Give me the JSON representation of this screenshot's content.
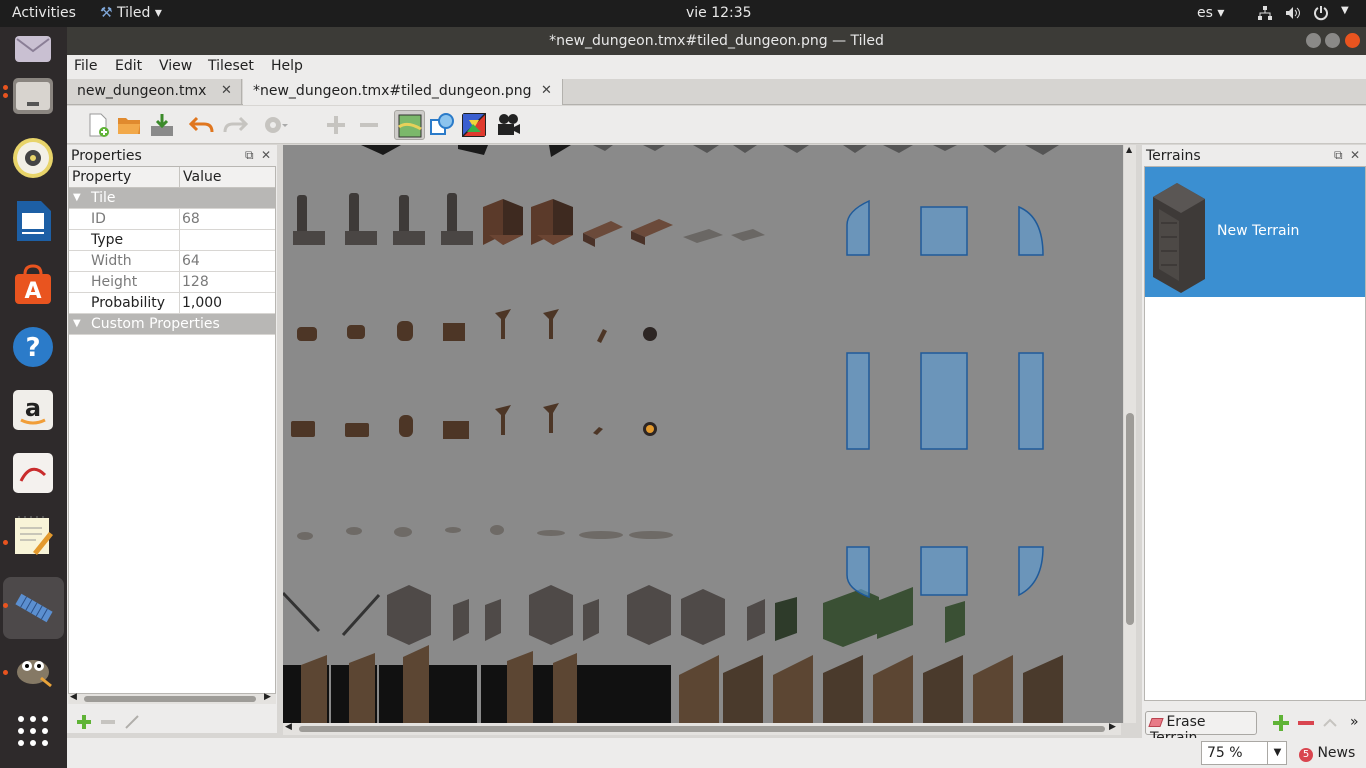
{
  "topbar": {
    "activities": "Activities",
    "app_menu": "Tiled ▾",
    "clock": "vie 12:35",
    "language": "es ▾"
  },
  "dock": {
    "items": [
      "mail-icon",
      "files-icon",
      "rhythmbox-icon",
      "writer-icon",
      "software-center-icon",
      "help-icon",
      "amazon-icon",
      "document-viewer-icon",
      "text-editor-icon",
      "tiled-icon",
      "gimp-icon",
      "apps-grid-icon"
    ]
  },
  "window": {
    "title": "*new_dungeon.tmx#tiled_dungeon.png — Tiled"
  },
  "menubar": {
    "file": "File",
    "edit": "Edit",
    "view": "View",
    "tileset": "Tileset",
    "help": "Help"
  },
  "tabs": [
    {
      "label": "new_dungeon.tmx"
    },
    {
      "label": "*new_dungeon.tmx#tiled_dungeon.png"
    }
  ],
  "properties": {
    "title": "Properties",
    "col_property": "Property",
    "col_value": "Value",
    "group_tile": "Tile",
    "rows": [
      {
        "name": "ID",
        "value": "68"
      },
      {
        "name": "Type",
        "value": ""
      },
      {
        "name": "Width",
        "value": "64"
      },
      {
        "name": "Height",
        "value": "128"
      },
      {
        "name": "Probability",
        "value": "1,000"
      }
    ],
    "group_custom": "Custom Properties"
  },
  "terrains": {
    "title": "Terrains",
    "item_label": "New Terrain",
    "erase_label": "Erase Terrain"
  },
  "status": {
    "zoom": "75 %",
    "news": "News"
  },
  "colors": {
    "selection": "#3b8fd1",
    "terrain_overlay": "#5a9bd4"
  }
}
